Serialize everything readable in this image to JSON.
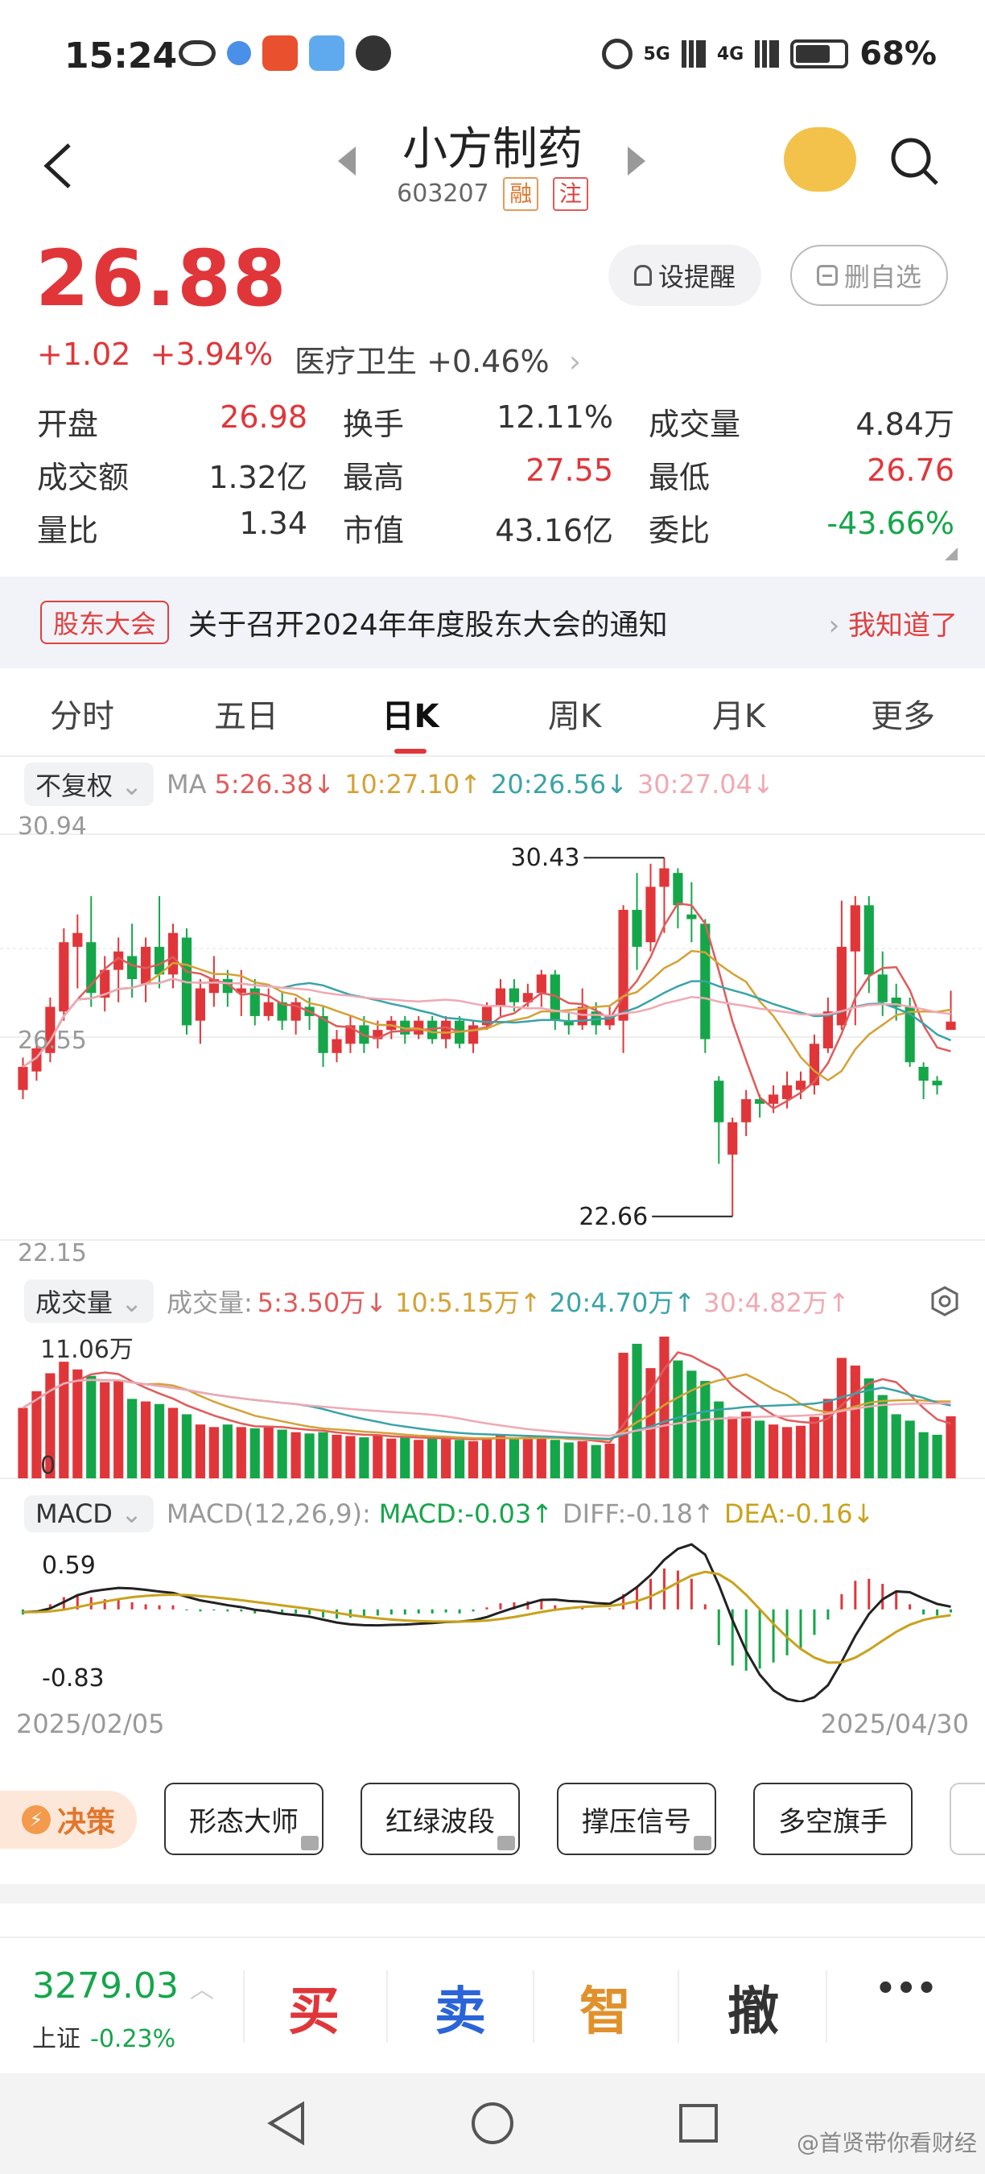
{
  "status": {
    "time": "15:24",
    "battery": "68%",
    "net1": "5G",
    "net2": "4G"
  },
  "header": {
    "title": "小方制药",
    "code": "603207",
    "tag1": "融",
    "tag2": "注"
  },
  "quote": {
    "price": "26.88",
    "change": "+1.02",
    "change_pct": "+3.94%",
    "sector": "医疗卫生 +0.46%",
    "remind_label": "设提醒",
    "remove_label": "删自选"
  },
  "stats": [
    [
      {
        "label": "开盘",
        "value": "26.98",
        "color": "red"
      },
      {
        "label": "换手",
        "value": "12.11%",
        "color": ""
      },
      {
        "label": "成交量",
        "value": "4.84万",
        "color": ""
      }
    ],
    [
      {
        "label": "成交额",
        "value": "1.32亿",
        "color": ""
      },
      {
        "label": "最高",
        "value": "27.55",
        "color": "red"
      },
      {
        "label": "最低",
        "value": "26.76",
        "color": "red"
      }
    ],
    [
      {
        "label": "量比",
        "value": "1.34",
        "color": ""
      },
      {
        "label": "市值",
        "value": "43.16亿",
        "color": ""
      },
      {
        "label": "委比",
        "value": "-43.66%",
        "color": "green"
      }
    ]
  ],
  "notice": {
    "badge": "股东大会",
    "text": "关于召开2024年年度股东大会的通知",
    "ack": "我知道了"
  },
  "tabs": [
    "分时",
    "五日",
    "日K",
    "周K",
    "月K",
    "更多"
  ],
  "ma_row": {
    "adjust": "不复权",
    "ma": "MA",
    "ma5": "5:26.38↓",
    "ma10": "10:27.10↑",
    "ma20": "20:26.56↓",
    "ma30": "30:27.04↓"
  },
  "kchart": {
    "max_label": "30.94",
    "mid_label": "26.55",
    "min_label": "22.15",
    "high_mark": "30.43",
    "low_mark": "22.66"
  },
  "vol_row": {
    "name": "成交量",
    "label": "成交量:",
    "v5": "5:3.50万↓",
    "v10": "10:5.15万↑",
    "v20": "20:4.70万↑",
    "v30": "30:4.82万↑",
    "max_label": "11.06万",
    "zero": "0"
  },
  "macd_row": {
    "name": "MACD",
    "params": "MACD(12,26,9):",
    "macd": "MACD:-0.03↑",
    "diff": "DIFF:-0.18↑",
    "dea": "DEA:-0.16↓",
    "top": "0.59",
    "bottom": "-0.83"
  },
  "dates": {
    "start": "2025/02/05",
    "end": "2025/04/30"
  },
  "strategy": {
    "decision": "决策",
    "buttons": [
      "形态大师",
      "红绿波段",
      "撑压信号",
      "多空旗手"
    ]
  },
  "bottom": {
    "index_value": "3279.03",
    "index_name": "上证",
    "index_change": "-0.23%",
    "buy": "买",
    "sell": "卖",
    "smart": "智",
    "cancel": "撤",
    "more": "•••"
  },
  "watermark": "@首贤带你看财经",
  "colors": {
    "up": "#e0363a",
    "down": "#15a64a",
    "ma5": "#e05b5b",
    "ma10": "#d4a236",
    "ma20": "#3aa3a8",
    "ma30": "#f0a9b4"
  },
  "chart_data": {
    "type": "candlestick",
    "candles": [
      [
        25.4,
        25.9,
        25.2,
        26.1
      ],
      [
        25.8,
        26.3,
        25.6,
        26.5
      ],
      [
        26.2,
        27.2,
        26.0,
        27.4
      ],
      [
        27.1,
        28.6,
        26.9,
        28.9
      ],
      [
        28.5,
        28.8,
        27.6,
        29.2
      ],
      [
        28.6,
        27.5,
        27.2,
        29.6
      ],
      [
        27.4,
        28.0,
        27.1,
        28.3
      ],
      [
        28.0,
        28.4,
        27.3,
        28.7
      ],
      [
        28.3,
        27.8,
        27.4,
        29.0
      ],
      [
        27.7,
        28.5,
        27.3,
        28.7
      ],
      [
        28.5,
        27.9,
        27.6,
        29.6
      ],
      [
        27.9,
        28.8,
        27.6,
        29.0
      ],
      [
        28.7,
        26.8,
        26.6,
        28.9
      ],
      [
        26.9,
        27.6,
        26.4,
        27.8
      ],
      [
        27.5,
        27.8,
        27.2,
        28.3
      ],
      [
        27.8,
        27.5,
        27.2,
        28.0
      ],
      [
        27.5,
        27.6,
        27.0,
        28.0
      ],
      [
        27.6,
        27.0,
        26.8,
        27.8
      ],
      [
        27.0,
        27.3,
        26.9,
        27.6
      ],
      [
        27.3,
        26.9,
        26.7,
        27.5
      ],
      [
        26.9,
        27.3,
        26.6,
        27.4
      ],
      [
        27.2,
        27.0,
        26.7,
        27.4
      ],
      [
        27.0,
        26.2,
        25.9,
        27.2
      ],
      [
        26.2,
        26.5,
        26.0,
        26.7
      ],
      [
        26.4,
        26.8,
        26.2,
        27.0
      ],
      [
        26.8,
        26.4,
        26.2,
        27.0
      ],
      [
        26.5,
        26.7,
        26.3,
        26.9
      ],
      [
        26.7,
        26.9,
        26.5,
        27.0
      ],
      [
        26.9,
        26.6,
        26.4,
        27.0
      ],
      [
        26.6,
        26.9,
        26.5,
        27.0
      ],
      [
        26.9,
        26.5,
        26.4,
        27.0
      ],
      [
        26.5,
        26.9,
        26.3,
        27.0
      ],
      [
        26.9,
        26.4,
        26.3,
        27.0
      ],
      [
        26.4,
        26.8,
        26.2,
        26.9
      ],
      [
        26.8,
        27.2,
        26.7,
        27.3
      ],
      [
        27.2,
        27.6,
        27.0,
        27.8
      ],
      [
        27.6,
        27.3,
        27.1,
        27.8
      ],
      [
        27.3,
        27.5,
        27.2,
        27.7
      ],
      [
        27.5,
        27.9,
        27.2,
        28.0
      ],
      [
        27.9,
        26.9,
        26.7,
        28.0
      ],
      [
        26.9,
        26.8,
        26.6,
        27.1
      ],
      [
        26.8,
        27.2,
        26.7,
        27.6
      ],
      [
        27.1,
        26.8,
        26.6,
        27.3
      ],
      [
        26.8,
        27.0,
        26.7,
        27.2
      ],
      [
        26.9,
        29.3,
        26.2,
        29.4
      ],
      [
        29.3,
        28.5,
        28.0,
        30.1
      ],
      [
        28.6,
        29.8,
        28.4,
        30.3
      ],
      [
        29.8,
        30.2,
        28.8,
        30.43
      ],
      [
        30.1,
        29.4,
        28.9,
        30.2
      ],
      [
        29.2,
        29.1,
        28.6,
        29.9
      ],
      [
        29.0,
        26.5,
        26.2,
        29.1
      ],
      [
        25.6,
        24.7,
        23.8,
        25.7
      ],
      [
        24.0,
        24.7,
        22.66,
        24.8
      ],
      [
        24.7,
        25.2,
        24.4,
        25.4
      ],
      [
        25.2,
        25.1,
        24.8,
        25.3
      ],
      [
        25.1,
        25.3,
        24.9,
        25.5
      ],
      [
        25.2,
        25.5,
        25.0,
        25.8
      ],
      [
        25.4,
        25.6,
        25.2,
        25.8
      ],
      [
        25.5,
        26.4,
        25.3,
        26.6
      ],
      [
        26.3,
        27.1,
        26.2,
        27.4
      ],
      [
        26.8,
        28.5,
        26.7,
        29.5
      ],
      [
        28.4,
        29.4,
        26.8,
        29.6
      ],
      [
        29.4,
        27.9,
        27.5,
        29.6
      ],
      [
        27.9,
        27.3,
        27.0,
        28.4
      ],
      [
        27.4,
        27.2,
        26.9,
        27.7
      ],
      [
        27.2,
        26.0,
        25.9,
        27.4
      ],
      [
        25.9,
        25.6,
        25.2,
        26.0
      ],
      [
        25.6,
        25.5,
        25.3,
        25.7
      ],
      [
        26.7,
        26.88,
        26.76,
        27.55
      ]
    ],
    "ylim": [
      22.15,
      30.94
    ],
    "volumes": [
      5.5,
      6.8,
      8.2,
      9.1,
      8.5,
      8.0,
      7.5,
      7.6,
      6.2,
      6.0,
      5.8,
      5.5,
      5.0,
      4.2,
      4.0,
      4.2,
      4.0,
      3.9,
      4.1,
      3.8,
      3.6,
      3.5,
      3.6,
      3.4,
      3.3,
      3.2,
      3.4,
      3.1,
      3.2,
      3.0,
      3.1,
      3.2,
      3.0,
      2.9,
      3.2,
      3.4,
      3.1,
      3.2,
      3.3,
      3.0,
      2.8,
      2.9,
      2.6,
      2.7,
      9.8,
      10.5,
      8.6,
      11.06,
      9.2,
      8.4,
      7.6,
      6.0,
      4.8,
      5.2,
      4.5,
      4.2,
      4.0,
      4.1,
      4.8,
      6.2,
      9.4,
      8.8,
      7.8,
      6.5,
      5.0,
      4.5,
      3.6,
      3.4,
      4.84
    ],
    "vlim": [
      0,
      11.06
    ],
    "macd_hist": [
      -0.05,
      0.0,
      0.05,
      0.12,
      0.15,
      0.12,
      0.1,
      0.1,
      0.07,
      0.05,
      0.04,
      0.04,
      -0.01,
      -0.02,
      -0.01,
      -0.02,
      -0.02,
      -0.04,
      -0.03,
      -0.05,
      -0.04,
      -0.05,
      -0.08,
      -0.09,
      -0.08,
      -0.07,
      -0.06,
      -0.05,
      -0.05,
      -0.04,
      -0.04,
      -0.03,
      -0.04,
      -0.02,
      0.02,
      0.06,
      0.07,
      0.08,
      0.09,
      0.04,
      0.01,
      0.02,
      0.0,
      0.01,
      0.15,
      0.22,
      0.3,
      0.4,
      0.38,
      0.3,
      0.05,
      -0.35,
      -0.55,
      -0.6,
      -0.58,
      -0.52,
      -0.45,
      -0.38,
      -0.25,
      -0.1,
      0.15,
      0.28,
      0.3,
      0.25,
      0.18,
      0.05,
      -0.05,
      -0.06,
      -0.03
    ],
    "macd_ylim": [
      -0.83,
      0.59
    ],
    "x_start": "2025/02/05",
    "x_end": "2025/04/30"
  }
}
